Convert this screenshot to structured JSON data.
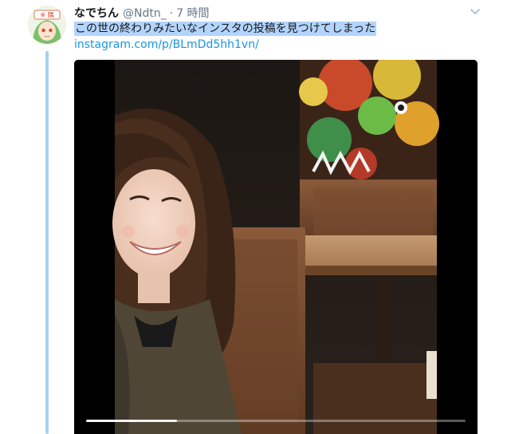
{
  "tweet": {
    "display_name": "なでちん",
    "handle": "@Ndtn_",
    "separator": "·",
    "timestamp": "7 時間",
    "text": "この世の終わりみたいなインスタの投稿を見つけてしまった",
    "link": "instagram.com/p/BLmDd5hh1vn/"
  },
  "avatar": {
    "badge_text": "※ 隣"
  },
  "video": {
    "progress_fraction": 0.24
  },
  "colors": {
    "link": "#1b95e0",
    "thread_line": "#a6d1ee",
    "selection": "#b3d4fc",
    "muted": "#657786"
  },
  "icons": {
    "more": "chevron-down-icon"
  }
}
